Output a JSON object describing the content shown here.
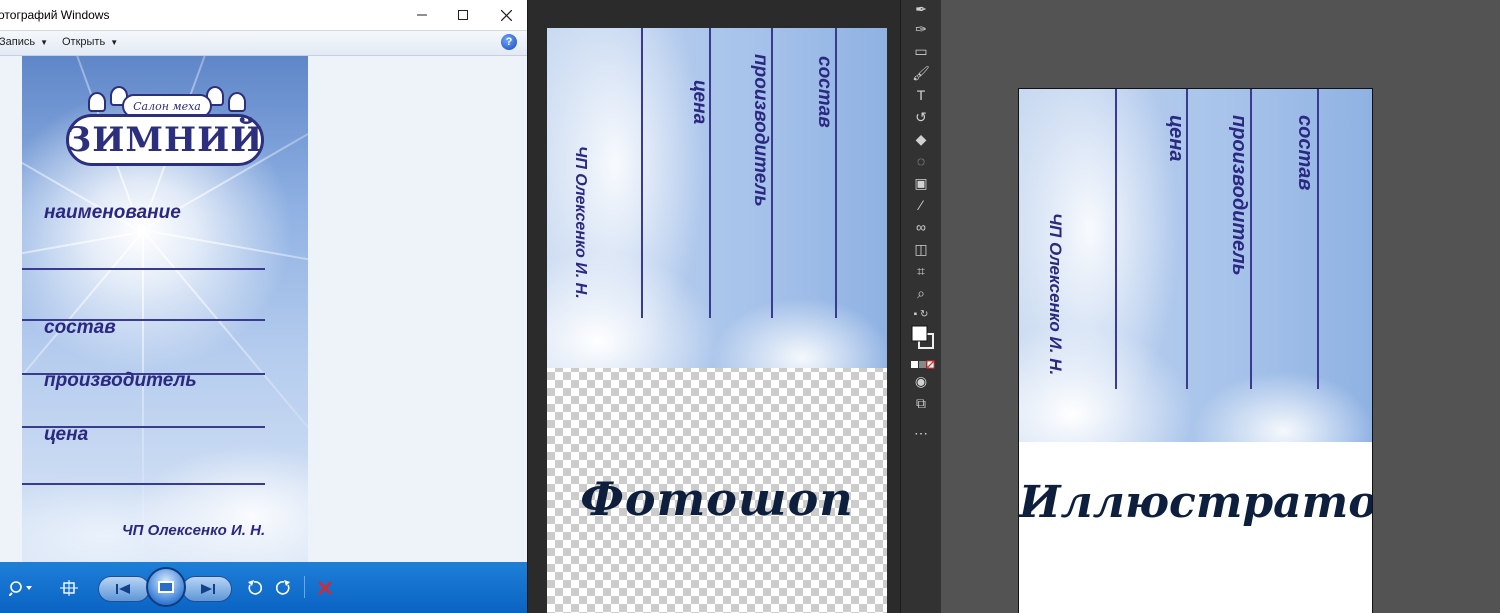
{
  "viewer": {
    "title": "отографий Windows",
    "menu": {
      "burn": "Запись",
      "open": "Открыть"
    },
    "tag": {
      "logo_small": "Салон меха",
      "logo_main": "ЗИМНИЙ",
      "name_label": "наименование",
      "composition_label": "состав",
      "manufacturer_label": "производитель",
      "price_label": "цена",
      "owner": "ЧП Олексенко И. Н."
    }
  },
  "photoshop": {
    "tag": {
      "price_label": "цена",
      "manufacturer_label": "производитель",
      "composition_label": "состав",
      "owner": "ЧП Олексенко И. Н."
    },
    "caption": "Фотошоп"
  },
  "illustrator": {
    "tag": {
      "price_label": "цена",
      "manufacturer_label": "производитель",
      "composition_label": "состав",
      "owner": "ЧП Олексенко И. Н."
    },
    "caption": "Иллюстратор"
  },
  "icons": [
    "pen-icon",
    "curvature-pen-icon",
    "rectangle-icon",
    "paintbrush-icon",
    "type-icon",
    "rotate-icon",
    "eraser-icon",
    "lasso-icon",
    "gradient-icon",
    "eyedropper-icon",
    "blend-icon",
    "shape-builder-icon",
    "artboard-icon",
    "zoom-icon",
    "swap-colors-icon",
    "fill-stroke-icon",
    "color-mode-icon",
    "draw-mode-icon",
    "screen-mode-icon",
    "more-tools-icon"
  ]
}
